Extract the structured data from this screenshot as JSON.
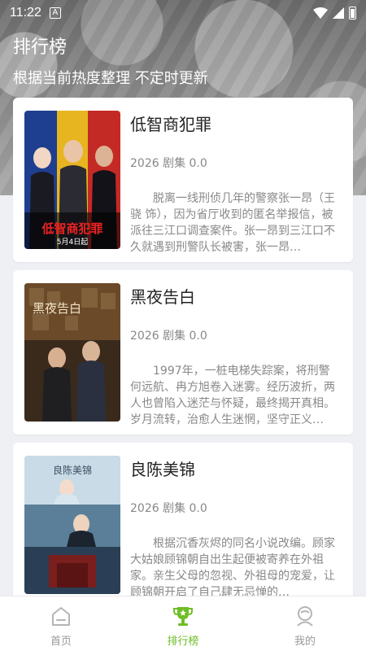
{
  "status": {
    "time": "11:22",
    "app_badge": "A"
  },
  "header": {
    "title": "排行榜",
    "subtitle": "根据当前热度整理 不定时更新"
  },
  "rankings": [
    {
      "title": "低智商犯罪",
      "meta": "2026 剧集 0.0",
      "description": "脱离一线刑侦几年的警察张一昂（王骁 饰），因为省厅收到的匿名举报信，被派往三江口调查案件。张一昂到三江口不久就遇到刑警队长被害，张一昂…",
      "poster": {
        "caption": "低智商犯罪",
        "date": "5月4日起"
      }
    },
    {
      "title": "黑夜告白",
      "meta": "2026 剧集 0.0",
      "description": "1997年，一桩电梯失踪案，将刑警何远航、冉方旭卷入迷雾。经历波折，两人也曾陷入迷茫与怀疑，最终揭开真相。岁月流转，治愈人生迷惘，坚守正义…",
      "poster": {
        "caption": "黑夜告白"
      }
    },
    {
      "title": "良陈美锦",
      "meta": "2026 剧集 0.0",
      "description": "根据沉香灰烬的同名小说改编。顾家大姑娘顾锦朝自出生起便被寄养在外祖家。亲生父母的忽视、外祖母的宠爱，让顾锦朝开启了自己肆无忌惮的…",
      "poster": {
        "caption": "良陈美锦"
      }
    }
  ],
  "nav": {
    "home": "首页",
    "ranking": "排行榜",
    "mine": "我的"
  },
  "colors": {
    "accent": "#6fbd26",
    "nav_inactive": "#999999"
  }
}
